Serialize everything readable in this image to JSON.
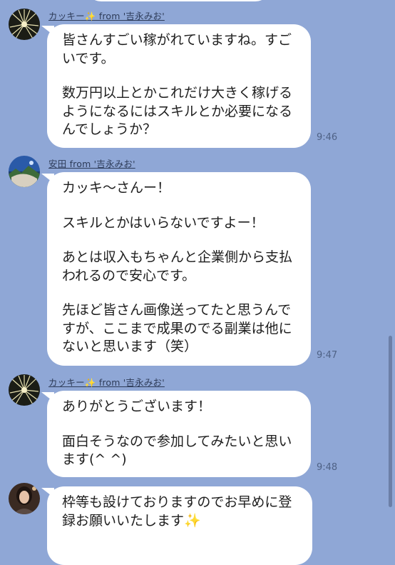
{
  "messages": [
    {
      "sender": "カッキー✨ from '吉永みお'",
      "avatar": "sparkler-avatar",
      "paragraphs": [
        "皆さんすごい稼がれていますね。すご\nいです。",
        "数万円以上とかこれだけ大きく稼げる\nようになるにはスキルとか必要になる\nんでしょうか？"
      ],
      "time": "9:46"
    },
    {
      "sender": "安田 from '吉永みお'",
      "avatar": "landscape-avatar",
      "paragraphs": [
        "カッキ〜さんー！",
        "スキルとかはいらないですよー！",
        "あとは収入もちゃんと企業側から支払\nわれるので安心です。",
        "先ほど皆さん画像送ってたと思うんで\nすが、ここまで成果のでる副業は他に\nないと思います（笑）"
      ],
      "time": "9:47"
    },
    {
      "sender": "カッキー✨ from '吉永みお'",
      "avatar": "sparkler-avatar",
      "paragraphs": [
        "ありがとうございます！",
        "面白そうなので参加してみたいと思い\nます(^ ^)"
      ],
      "time": "9:48"
    },
    {
      "sender": "",
      "avatar": "person-avatar",
      "paragraphs": [
        "枠等も設けておりますのでお早めに登\n録お願いいたします✨"
      ],
      "time": ""
    }
  ]
}
